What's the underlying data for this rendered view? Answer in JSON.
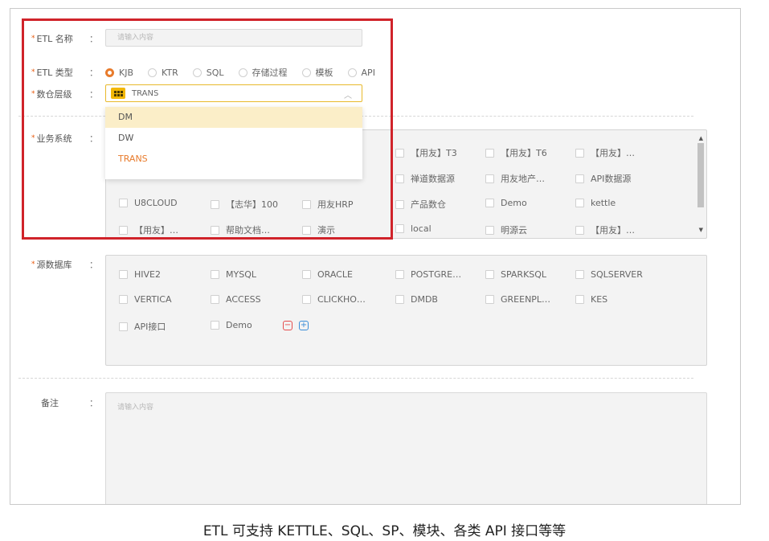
{
  "form": {
    "etl_name": {
      "label": "ETL 名称",
      "placeholder": "请输入内容"
    },
    "etl_type": {
      "label": "ETL 类型",
      "options": [
        "KJB",
        "KTR",
        "SQL",
        "存储过程",
        "模板",
        "API"
      ],
      "selected": "KJB"
    },
    "warehouse_layer": {
      "label": "数仓层级",
      "value": "TRANS",
      "icon": "grid-icon",
      "dropdown": [
        {
          "label": "DM",
          "state": "hover"
        },
        {
          "label": "DW",
          "state": ""
        },
        {
          "label": "TRANS",
          "state": "selected"
        }
      ]
    },
    "business_system": {
      "label": "业务系统",
      "visible_items": [
        [
          "【用友】T3",
          "【用友】T6",
          "【用友】…"
        ],
        [
          "禅道数据源",
          "用友地产…",
          "API数据源"
        ],
        [
          "U8CLOUD",
          "【志华】100",
          "用友HRP",
          "产品数仓",
          "Demo",
          "kettle"
        ],
        [
          "【用友】…",
          "帮助文档…",
          "演示",
          "local",
          "明源云",
          "【用友】…"
        ]
      ]
    },
    "source_db": {
      "label": "源数据库",
      "items": [
        [
          "HIVE2",
          "MYSQL",
          "ORACLE",
          "POSTGRE…",
          "SPARKSQL",
          "SQLSERVER"
        ],
        [
          "VERTICA",
          "ACCESS",
          "CLICKHO…",
          "DMDB",
          "GREENPL…",
          "KES"
        ],
        [
          "API接口",
          "Demo"
        ]
      ]
    },
    "remark": {
      "label": "备注",
      "placeholder": "请输入内容"
    },
    "colon": "："
  },
  "caption": "ETL 可支持 KETTLE、SQL、SP、模块、各类 API 接口等等",
  "colors": {
    "accent": "#e87b2c",
    "highlight_border": "#d0232a",
    "select_border": "#e8b92c"
  }
}
